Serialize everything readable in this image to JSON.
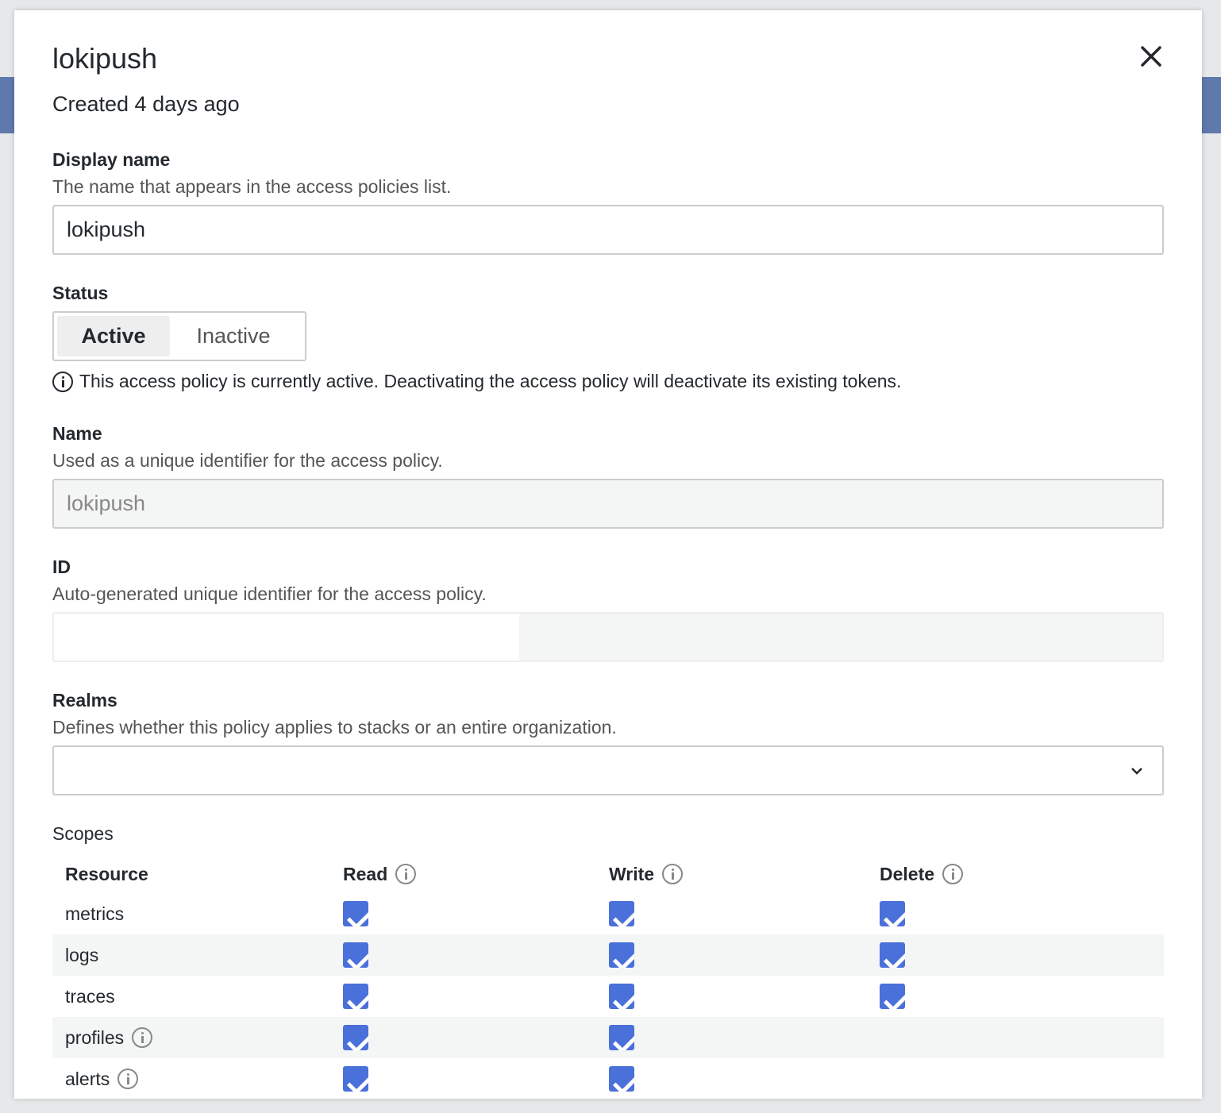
{
  "title": "lokipush",
  "created": "Created 4 days ago",
  "display_name": {
    "label": "Display name",
    "description": "The name that appears in the access policies list.",
    "value": "lokipush"
  },
  "status": {
    "label": "Status",
    "options": [
      "Active",
      "Inactive"
    ],
    "selected": "Active",
    "note": "This access policy is currently active. Deactivating the access policy will deactivate its existing tokens."
  },
  "name": {
    "label": "Name",
    "description": "Used as a unique identifier for the access policy.",
    "value": "lokipush"
  },
  "id": {
    "label": "ID",
    "description": "Auto-generated unique identifier for the access policy.",
    "value": ""
  },
  "realms": {
    "label": "Realms",
    "description": "Defines whether this policy applies to stacks or an entire organization.",
    "value": ""
  },
  "scopes": {
    "label": "Scopes",
    "headers": [
      "Resource",
      "Read",
      "Write",
      "Delete"
    ],
    "rows": [
      {
        "resource": "metrics",
        "info": false,
        "read": true,
        "write": true,
        "delete": true
      },
      {
        "resource": "logs",
        "info": false,
        "read": true,
        "write": true,
        "delete": true
      },
      {
        "resource": "traces",
        "info": false,
        "read": true,
        "write": true,
        "delete": true
      },
      {
        "resource": "profiles",
        "info": true,
        "read": true,
        "write": true,
        "delete": null
      },
      {
        "resource": "alerts",
        "info": true,
        "read": true,
        "write": true,
        "delete": null
      }
    ]
  },
  "colors": {
    "accent": "#4a70d9"
  }
}
